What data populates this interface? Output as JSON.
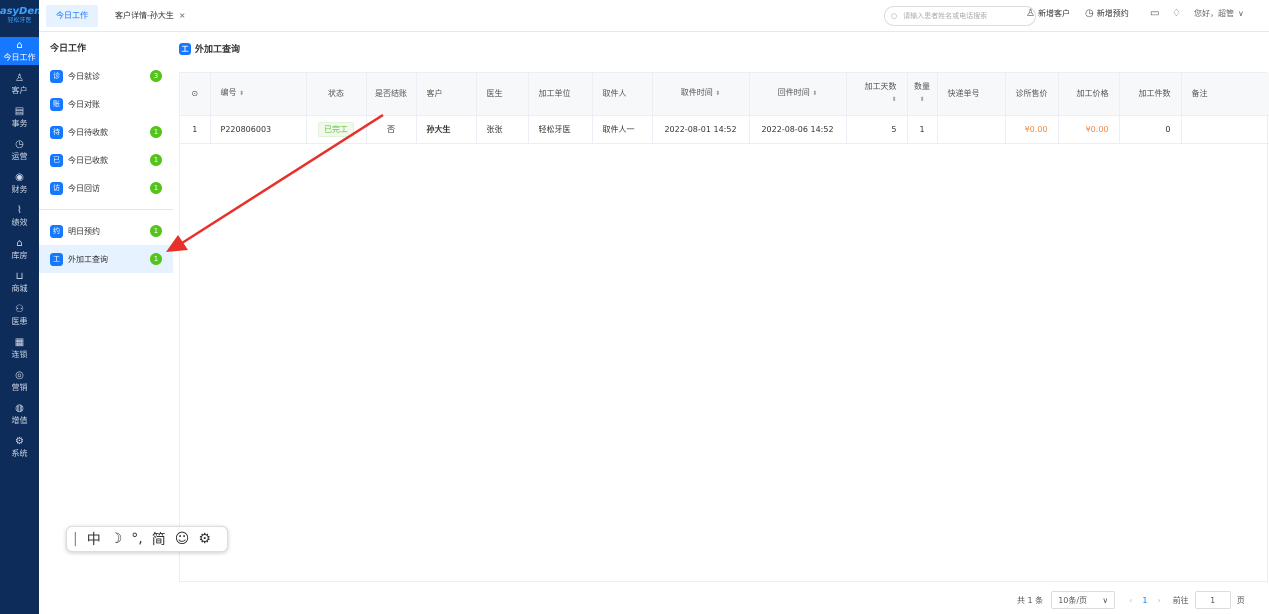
{
  "logo": {
    "line1": "EasyDent",
    "line2": "轻松牙医"
  },
  "leftnav": [
    {
      "icon": "⌂",
      "label": "今日工作"
    },
    {
      "icon": "♙",
      "label": "客户"
    },
    {
      "icon": "▤",
      "label": "事务"
    },
    {
      "icon": "◷",
      "label": "运营"
    },
    {
      "icon": "◉",
      "label": "财务"
    },
    {
      "icon": "⌇",
      "label": "绩效"
    },
    {
      "icon": "⌂",
      "label": "库房"
    },
    {
      "icon": "⊔",
      "label": "商城"
    },
    {
      "icon": "⚇",
      "label": "医患"
    },
    {
      "icon": "▦",
      "label": "连锁"
    },
    {
      "icon": "◎",
      "label": "营销"
    },
    {
      "icon": "◍",
      "label": "增值"
    },
    {
      "icon": "⚙",
      "label": "系统"
    }
  ],
  "tabs": [
    {
      "label": "今日工作"
    },
    {
      "label": "客户详情-孙大生",
      "close": "×"
    }
  ],
  "search": {
    "placeholder": "请输入患者姓名或电话搜索"
  },
  "topbar": {
    "new_customer": "新增客户",
    "new_appointment": "新增预约",
    "greeting": "您好，超管"
  },
  "subnav": {
    "title": "今日工作",
    "items": [
      {
        "icon": "诊",
        "label": "今日就诊",
        "badge": "3"
      },
      {
        "icon": "账",
        "label": "今日对账",
        "badge": ""
      },
      {
        "icon": "待",
        "label": "今日待收款",
        "badge": "1"
      },
      {
        "icon": "已",
        "label": "今日已收款",
        "badge": "1"
      },
      {
        "icon": "访",
        "label": "今日回访",
        "badge": "1"
      }
    ],
    "items2": [
      {
        "icon": "约",
        "label": "明日预约",
        "badge": "1"
      },
      {
        "icon": "工",
        "label": "外加工查询",
        "badge": "1"
      }
    ]
  },
  "page": {
    "title": "外加工查询",
    "title_icon": "工"
  },
  "table": {
    "columns": [
      "编号",
      "状态",
      "是否结账",
      "客户",
      "医生",
      "加工单位",
      "取件人",
      "取件时间",
      "回件时间",
      "加工天数",
      "数量",
      "快递单号",
      "诊所售价",
      "加工价格",
      "加工件数",
      "备注"
    ],
    "rows": [
      {
        "index": "1",
        "code": "P220806003",
        "status": "已完工",
        "settled": "否",
        "customer": "孙大生",
        "doctor": "张张",
        "unit": "轻松牙医",
        "picker": "取件人一",
        "pick_time": "2022-08-01 14:52",
        "return_time": "2022-08-06 14:52",
        "days": "5",
        "qty": "1",
        "express": "",
        "price": "¥0.00",
        "cost": "¥0.00",
        "pieces": "0",
        "remark": ""
      }
    ]
  },
  "pager": {
    "total": "共 1 条",
    "size": "10条/页",
    "page": "1",
    "goto": "前往",
    "unit": "页",
    "prev": "‹",
    "next": "›"
  },
  "ime": {
    "items": [
      "中",
      "☽",
      "°,",
      "简",
      "☺",
      "⚙"
    ]
  },
  "colors": {
    "primary": "#1677ff",
    "sidebar": "#0d2c59",
    "badge": "#52c41a",
    "price": "#f0883e",
    "arrow": "#e8302a"
  }
}
